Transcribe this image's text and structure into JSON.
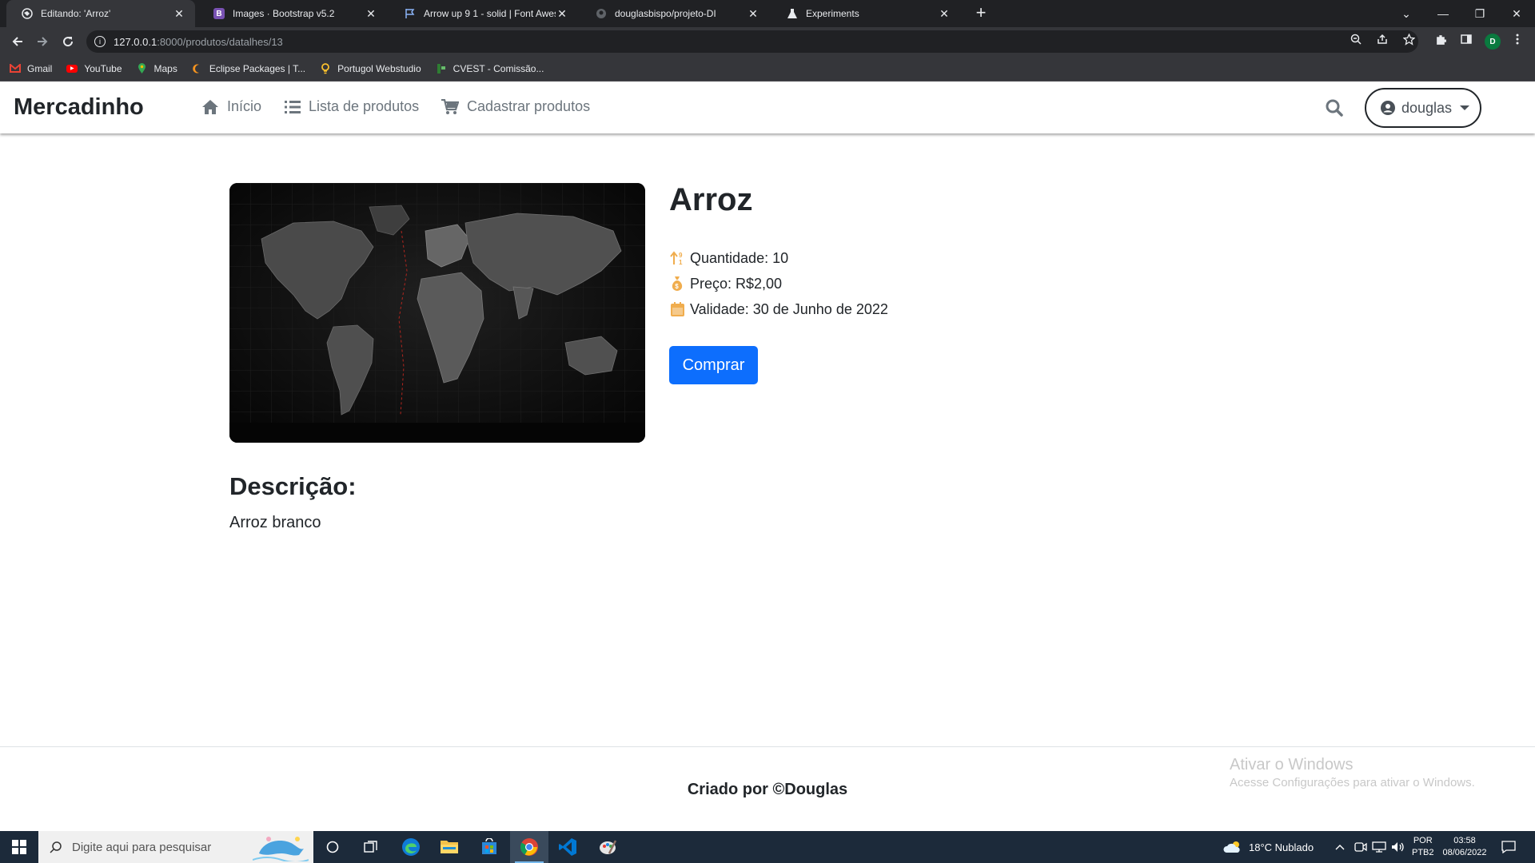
{
  "browser": {
    "tabs": [
      {
        "title": "Editando: 'Arroz'",
        "icon": "globe-icon",
        "active": true
      },
      {
        "title": "Images · Bootstrap v5.2",
        "icon": "bootstrap-icon",
        "active": false
      },
      {
        "title": "Arrow up 9 1 - solid | Font Awesom",
        "icon": "flag-icon",
        "active": false
      },
      {
        "title": "douglasbispo/projeto-DI",
        "icon": "github-icon",
        "active": false
      },
      {
        "title": "Experiments",
        "icon": "flask-icon",
        "active": false
      }
    ],
    "url_host": "127.0.0.1",
    "url_path": ":8000/produtos/datalhes/13",
    "profile_initial": "D",
    "bookmarks": [
      {
        "label": "Gmail",
        "icon": "gmail-icon"
      },
      {
        "label": "YouTube",
        "icon": "youtube-icon"
      },
      {
        "label": "Maps",
        "icon": "maps-icon"
      },
      {
        "label": "Eclipse Packages | T...",
        "icon": "eclipse-icon"
      },
      {
        "label": "Portugol Webstudio",
        "icon": "bulb-icon"
      },
      {
        "label": "CVEST - Comissão...",
        "icon": "cvest-icon"
      }
    ]
  },
  "navbar": {
    "brand": "Mercadinho",
    "links": [
      {
        "label": "Início",
        "icon": "home-icon"
      },
      {
        "label": "Lista de produtos",
        "icon": "list-icon"
      },
      {
        "label": "Cadastrar produtos",
        "icon": "cart-icon"
      }
    ],
    "user": "douglas"
  },
  "product": {
    "name": "Arroz",
    "quantity": "Quantidade: 10",
    "price": "Preço: R$2,00",
    "validity": "Validade: 30 de Junho de 2022",
    "buy_label": "Comprar",
    "description_title": "Descrição:",
    "description": "Arroz branco"
  },
  "footer": {
    "text": "Criado por ©Douglas"
  },
  "watermark": {
    "title": "Ativar o Windows",
    "subtitle": "Acesse Configurações para ativar o Windows."
  },
  "taskbar": {
    "search_placeholder": "Digite aqui para pesquisar",
    "weather": "18°C  Nublado",
    "lang_top": "POR",
    "lang_bottom": "PTB2",
    "time": "03:58",
    "date": "08/06/2022"
  },
  "colors": {
    "primary": "#0d6efd",
    "icon_orange": "#f0ad4e",
    "taskbar": "#1c2a3a"
  }
}
